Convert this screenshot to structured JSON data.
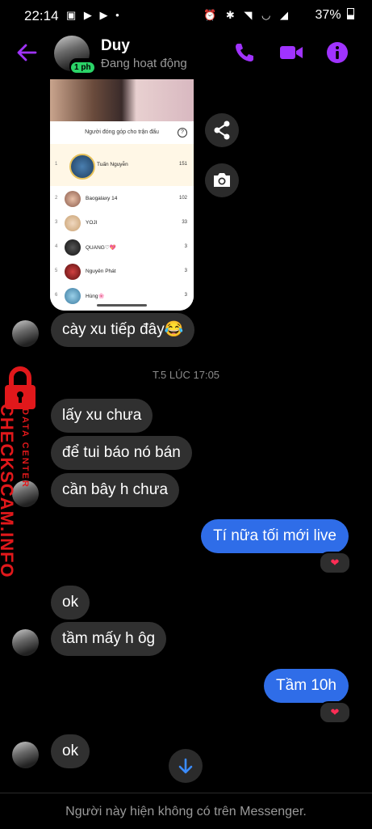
{
  "status_bar": {
    "time": "22:14",
    "left_icons": "▣ ▶ ▶ •",
    "right_icons": "⏰ ✱ ◥ ◡ ◢",
    "battery": "37%"
  },
  "header": {
    "name": "Duy",
    "status": "Đang hoạt động",
    "active_badge": "1 ph",
    "accent": "#a033ff"
  },
  "shared_card": {
    "title": "Người đóng góp cho trận đấu",
    "help": "?",
    "rows": [
      {
        "rank": "1",
        "name": "Tuấn Nguyễn",
        "score": "151"
      },
      {
        "rank": "2",
        "name": "Baogalaxy 14",
        "score": "102"
      },
      {
        "rank": "3",
        "name": "YOJI",
        "score": "33"
      },
      {
        "rank": "4",
        "name": "QUANG♡💖",
        "score": "3"
      },
      {
        "rank": "5",
        "name": "Nguyên Phát",
        "score": "3"
      },
      {
        "rank": "6",
        "name": "Hùng🌸",
        "score": "3"
      }
    ]
  },
  "messages": {
    "m1": "cày xu tiếp đây😂",
    "sep1": "T.5 LÚC 17:05",
    "m2": "lấy xu chưa",
    "m3": "để tui báo nó bán",
    "m4": "cần bây h chưa",
    "m5": "Tí nữa tối mới live",
    "m6": "ok",
    "m7": "tầm mấy h ôg",
    "m8": "Tầm 10h",
    "m9": "ok",
    "react": "❤"
  },
  "watermark": {
    "line1": "DATA CENTER",
    "line2": "CHECKSCAM.INFO"
  },
  "footer": {
    "text": "Người này hiện không có trên Messenger."
  },
  "colors": {
    "accent_purple": "#a033ff",
    "outgoing_blue": "#2f6de8",
    "incoming_gray": "#303030",
    "watermark_red": "#e1181b"
  }
}
